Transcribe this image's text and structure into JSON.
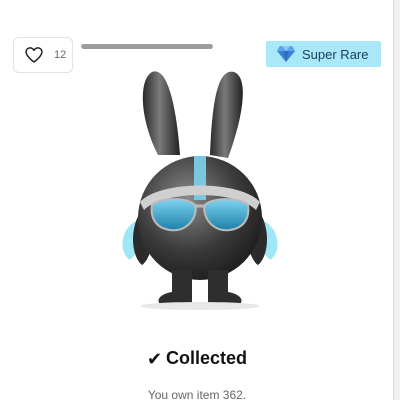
{
  "like": {
    "count": "12",
    "icon": "heart-outline-icon"
  },
  "progress": {
    "fraction": 1.0
  },
  "rarity": {
    "label": "Super Rare",
    "icon": "diamond-icon",
    "badge_color": "#a8e8f8"
  },
  "status": {
    "icon": "checkmark-icon",
    "label": "Collected"
  },
  "ownership": {
    "text": "You own item 362."
  }
}
